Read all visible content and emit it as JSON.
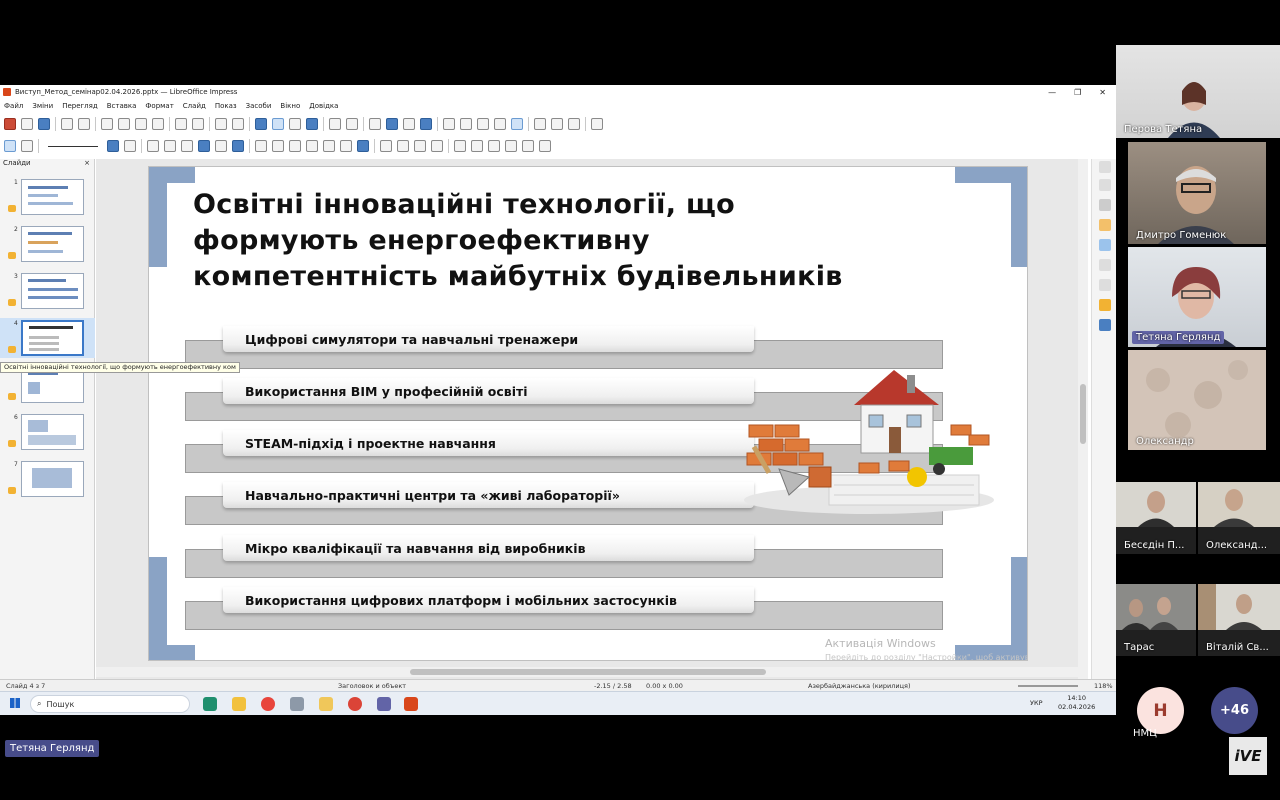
{
  "window": {
    "title": "Виступ_Метод_семінар02.04.2026.pptx — LibreOffice Impress",
    "minimize": "—",
    "restore": "❐",
    "close": "✕"
  },
  "menu": [
    "Файл",
    "Зміни",
    "Перегляд",
    "Вставка",
    "Формат",
    "Слайд",
    "Показ",
    "Засоби",
    "Вікно",
    "Довідка"
  ],
  "slides_panel": {
    "title": "Слайди",
    "close": "×",
    "numbers": [
      "1",
      "2",
      "3",
      "4",
      "5",
      "6",
      "7"
    ],
    "tooltip": "Освітні інноваційні технології, що формують енергоефективну ком"
  },
  "slide": {
    "title_line1": "Освітні інноваційні технології, що",
    "title_line2": "формують енергоефективну",
    "title_line3": "компетентність майбутніх будівельників",
    "items": [
      "Цифрові симулятори та навчальні тренажери",
      "Використання BIM у професійній освіті",
      "STEAM-підхід і проектне навчання",
      "Навчально-практичні центри та «живі лабораторії»",
      "Мікро кваліфікації та навчання від виробників",
      "Використання цифрових платформ і мобільних застосунків"
    ],
    "watermark": "Активація Windows",
    "watermark_sub": "Перейдіть до розділу \"Настройки\", щоб активувати Windows"
  },
  "status": {
    "slide_num": "Слайд 4 з 7",
    "layout": "Заголовок и объект",
    "coords": "-2.15 / 2.58",
    "size": "0.00 x 0.00",
    "language": "Азербайджанська (кирилиця)",
    "zoom": "118%"
  },
  "taskbar": {
    "search": "Пошук",
    "lang": "УКР",
    "time": "14:10",
    "date": "02.04.2026"
  },
  "participants": [
    {
      "name": "Перова Тетяна"
    },
    {
      "name": "Дмитро Гоменюк"
    },
    {
      "name": "Тетяна Герлянд"
    },
    {
      "name": "Олександр"
    },
    {
      "name": "Бесєдін П..."
    },
    {
      "name": "Олександ..."
    },
    {
      "name": "Тарас"
    },
    {
      "name": "Віталій Св..."
    }
  ],
  "overflow": {
    "avatar_initial": "Н",
    "avatar_name": "НМЦ",
    "more": "+46"
  },
  "active_speaker": "Тетяна Герлянд",
  "logo": "iVE"
}
